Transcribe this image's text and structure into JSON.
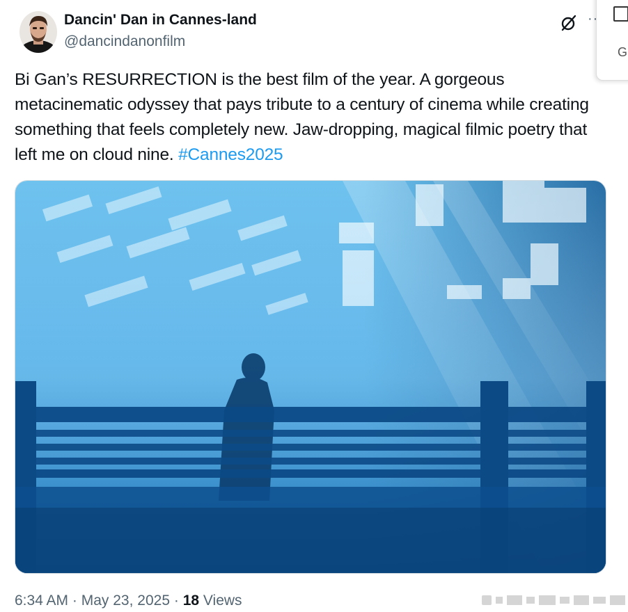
{
  "author": {
    "name": "Dancin' Dan in Cannes-land",
    "handle": "@dancindanonfilm"
  },
  "tweet": {
    "text": "Bi Gan’s RESURRECTION is the best film of the year. A gorgeous metacinematic odyssey that pays tribute to a century of cinema while creating something that feels completely new. Jaw-dropping, magical filmic poetry that left me on cloud nine. ",
    "hashtag": "#Cannes2025"
  },
  "meta": {
    "time": "6:34 AM",
    "separator": "·",
    "date": "May 23, 2025",
    "views_count": "18",
    "views_label": "Views"
  },
  "side_panel": {
    "letter": "G"
  },
  "icons": {
    "grok": "grok-icon",
    "more": "more-dots-icon"
  },
  "colors": {
    "text_primary": "#0f1419",
    "text_secondary": "#536471",
    "link": "#1d9bf0",
    "media_tint": "#1e90d8"
  }
}
